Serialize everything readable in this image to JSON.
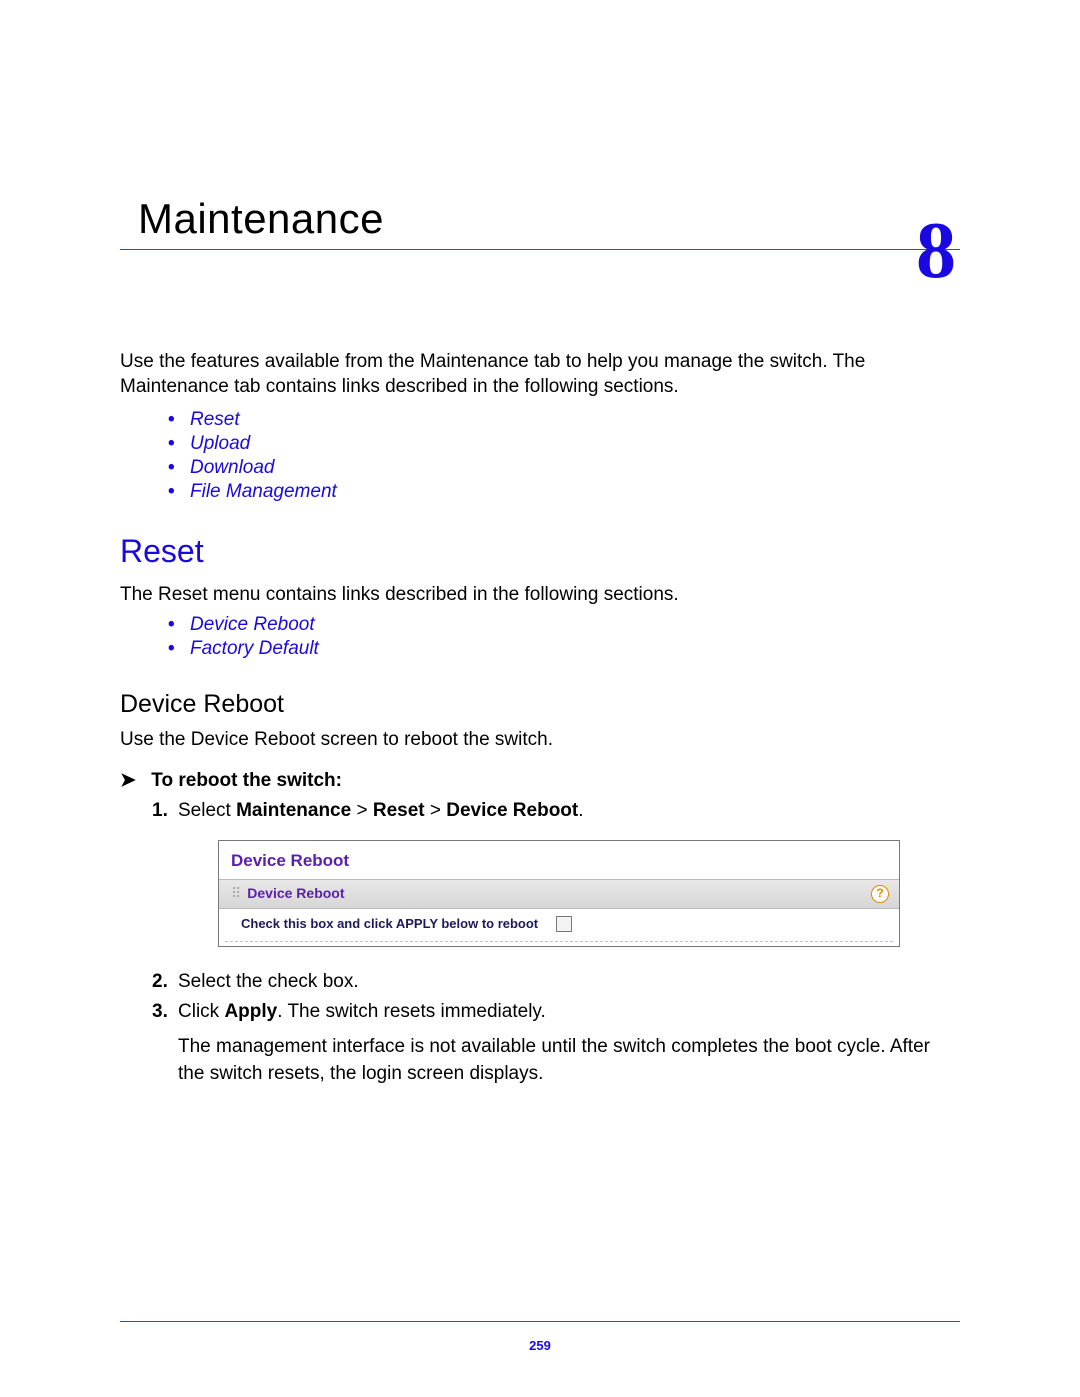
{
  "chapter": {
    "title": "Maintenance",
    "number": "8"
  },
  "intro": "Use the features available from the Maintenance tab to help you manage the switch. The Maintenance tab contains links described in the following sections.",
  "links1": [
    "Reset",
    "Upload",
    "Download",
    "File Management"
  ],
  "section_reset": {
    "heading": "Reset",
    "body": "The Reset menu contains links described in the following sections.",
    "links": [
      "Device Reboot",
      "Factory Default"
    ]
  },
  "device_reboot": {
    "heading": "Device Reboot",
    "body": "Use the Device Reboot screen to reboot the switch.",
    "task": "To reboot the switch:",
    "step1": {
      "prefix": "Select ",
      "path": [
        "Maintenance",
        "Reset",
        "Device Reboot"
      ],
      "sep": " > ",
      "suffix": "."
    },
    "step2": "Select the check box.",
    "step3_a": "Click ",
    "step3_b": "Apply",
    "step3_c": ". The switch resets immediately.",
    "step3_sub": "The management interface is not available until the switch completes the boot cycle. After the switch resets, the login screen displays."
  },
  "ui": {
    "panel_title": "Device Reboot",
    "sub_title": "Device Reboot",
    "help": "?",
    "row_label": "Check this box and click APPLY below to reboot"
  },
  "page_number": "259"
}
